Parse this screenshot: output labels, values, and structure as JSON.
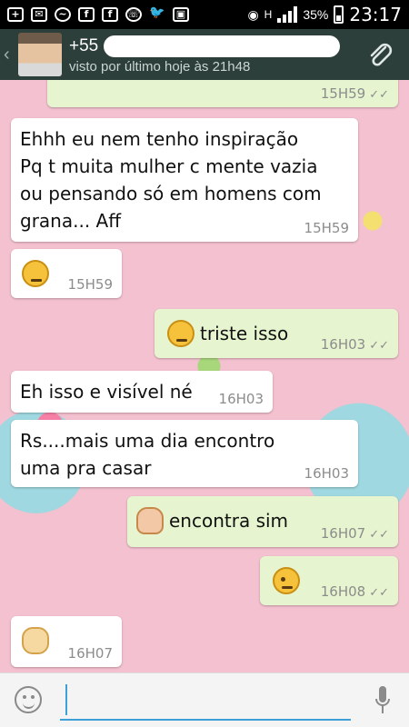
{
  "status_bar": {
    "battery": "35%",
    "time": "23:17",
    "network": "H"
  },
  "header": {
    "contact_prefix": "+55",
    "last_seen": "visto por último hoje às 21h48"
  },
  "messages": [
    {
      "id": "m0",
      "direction": "out",
      "text": "",
      "time": "15H59",
      "status": "read"
    },
    {
      "id": "m1",
      "direction": "in",
      "lines": [
        "Ehhh eu nem tenho inspiração",
        "Pq t muita mulher c mente vazia",
        "ou pensando só em homens com",
        "grana... Aff"
      ],
      "time": "15H59"
    },
    {
      "id": "m2",
      "direction": "in",
      "emoji": "angry-face",
      "time": "15H59"
    },
    {
      "id": "m3",
      "direction": "out",
      "emoji": "sweat-smile",
      "text": "triste isso",
      "time": "16H03",
      "status": "read"
    },
    {
      "id": "m4",
      "direction": "in",
      "text": "Eh isso e visível né",
      "time": "16H03"
    },
    {
      "id": "m5",
      "direction": "in",
      "lines": [
        "Rs....mais uma dia encontro",
        "uma pra casar"
      ],
      "time": "16H03"
    },
    {
      "id": "m6",
      "direction": "out",
      "emoji": "woman-shrugging",
      "text": "encontra sim",
      "time": "16H07",
      "status": "read"
    },
    {
      "id": "m7",
      "direction": "out",
      "emoji": "winking-face",
      "time": "16H08",
      "status": "read"
    },
    {
      "id": "m8",
      "direction": "in",
      "emoji": "clapping-hands",
      "time": "16H07"
    }
  ],
  "colors": {
    "header_bg": "#2d3f3b",
    "outgoing_bubble": "#e6f5cf",
    "incoming_bubble": "#ffffff",
    "chat_bg": "#f3c1cf",
    "input_accent": "#3fa0d8"
  }
}
